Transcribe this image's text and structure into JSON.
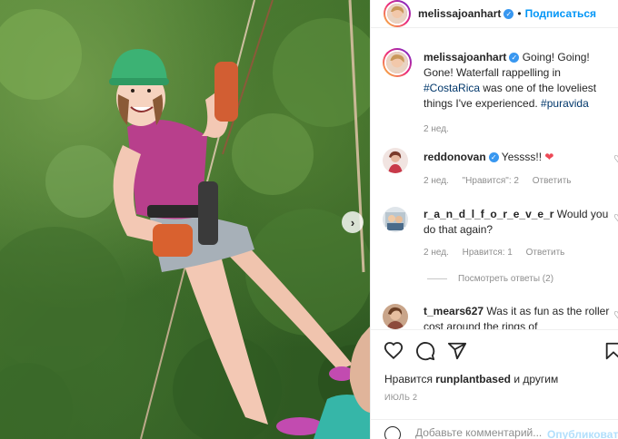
{
  "post": {
    "author": "melissajoanhart",
    "follow_label": "Подписаться",
    "caption_start": "Going! Going! Gone! Waterfall rappelling in ",
    "caption_tag1": "#CostaRica",
    "caption_mid": " was one of the loveliest things I've experienced. ",
    "caption_tag2": "#puravida",
    "caption_time": "2 нед."
  },
  "comments": [
    {
      "username": "reddonovan",
      "verified": true,
      "text": "Yessss!! ",
      "emoji": "❤",
      "time": "2 нед.",
      "likes": "\"Нравится\": 2",
      "reply": "Ответить"
    },
    {
      "username": "r_a_n_d_l_f_o_r_e_v_e_r",
      "verified": false,
      "text": "Would you do that again?",
      "time": "2 нед.",
      "likes": "Нравится: 1",
      "reply": "Ответить",
      "view_replies": "Посмотреть ответы (2)"
    },
    {
      "username": "t_mears627",
      "verified": false,
      "text": "Was it as fun as the roller cost around the rings of"
    }
  ],
  "footer": {
    "likes_prefix": "Нравится ",
    "likes_user": "runplantbased",
    "likes_suffix": " и другим",
    "date": "ИЮЛЬ 2",
    "comment_placeholder": "Добавьте комментарий...",
    "post_label": "Опубликовать"
  },
  "icons": {
    "like": "heart-icon",
    "comment": "comment-icon",
    "share": "send-icon",
    "save": "bookmark-icon",
    "emoji": "smiley-icon",
    "next": "chevron-right-icon",
    "verified": "verified-badge-icon"
  },
  "colors": {
    "link": "#00376b",
    "follow": "#0095f6",
    "verified": "#3897f0",
    "heart_red": "#ed4956"
  }
}
